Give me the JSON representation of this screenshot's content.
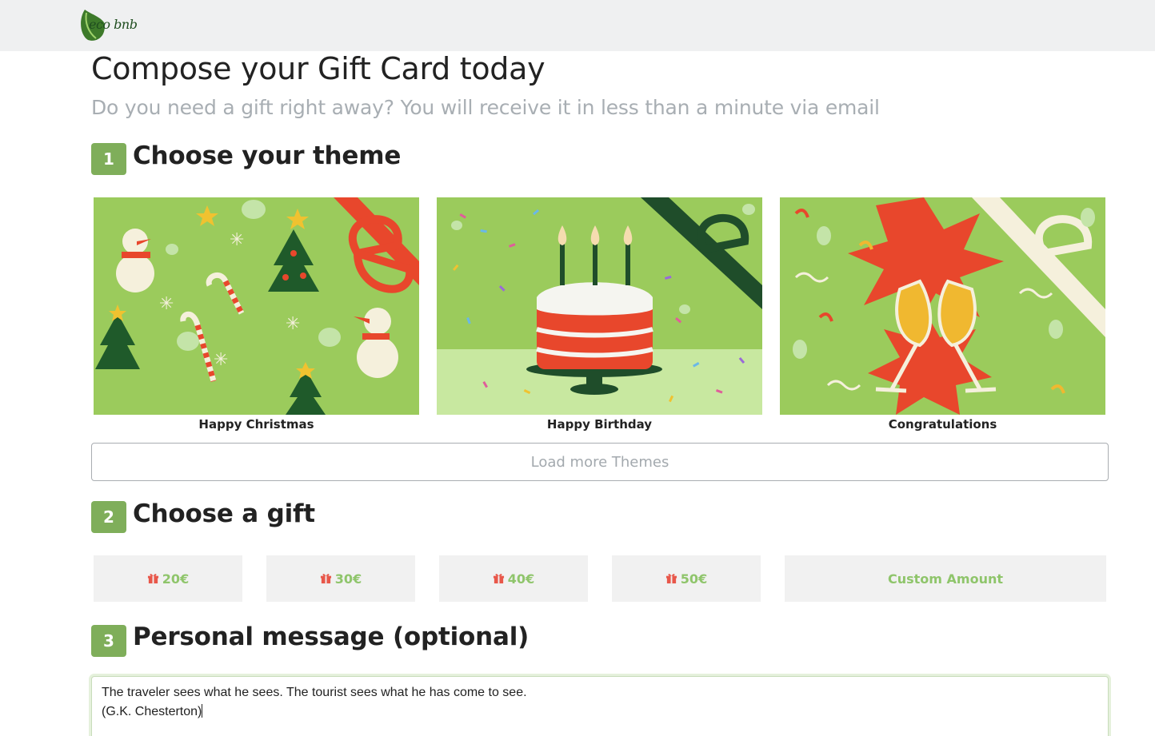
{
  "header": {
    "logo_text": "eco bnb",
    "logo_icon": "leaf-icon"
  },
  "page": {
    "title": "Compose your Gift Card today",
    "subtitle": "Do you need a gift right away? You will receive it in less than a minute via email"
  },
  "steps": [
    {
      "number": "1",
      "title": "Choose your theme"
    },
    {
      "number": "2",
      "title": "Choose a gift"
    },
    {
      "number": "3",
      "title": "Personal message (optional)"
    }
  ],
  "themes": [
    {
      "label": "Happy Christmas",
      "image": "christmas-theme-image"
    },
    {
      "label": "Happy Birthday",
      "image": "birthday-theme-image"
    },
    {
      "label": "Congratulations",
      "image": "congratulations-theme-image"
    }
  ],
  "load_more_label": "Load more Themes",
  "gifts": [
    {
      "label": "20€",
      "icon": "gift-icon"
    },
    {
      "label": "30€",
      "icon": "gift-icon"
    },
    {
      "label": "40€",
      "icon": "gift-icon"
    },
    {
      "label": "50€",
      "icon": "gift-icon"
    }
  ],
  "custom_amount_label": "Custom Amount",
  "message": {
    "line1": "The traveler sees what he sees. The tourist sees what he has come to see.",
    "line2": "(G.K. Chesterton)"
  },
  "colors": {
    "accent_green": "#7fae5a",
    "gift_text_green": "#8fc56b",
    "gift_icon_red": "#e8574a",
    "card_background_green": "#9bcb5c",
    "topbar_gray": "#eff0f1"
  }
}
